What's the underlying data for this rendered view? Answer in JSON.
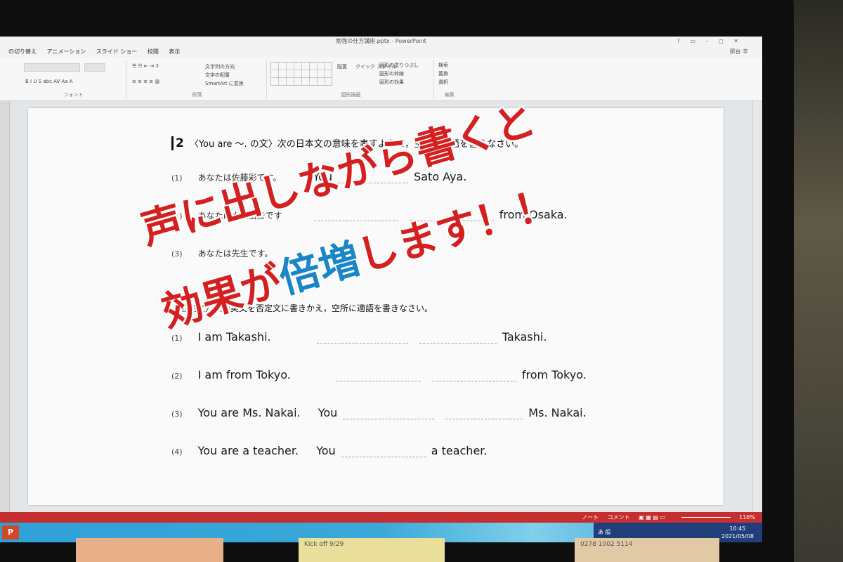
{
  "window": {
    "title": "勉強の仕方講座.pptx - PowerPoint",
    "controls": "?  ▭  –  ◻  ✕"
  },
  "tabs": [
    "の切り替え",
    "アニメーション",
    "スライド ショー",
    "校閲",
    "表示"
  ],
  "user": "那台 辛",
  "ribbon": {
    "groups": [
      "フォント",
      "段落",
      "図形描画",
      "編集"
    ],
    "items": {
      "text_direction": "文字列の方向",
      "align_text": "文字の配置",
      "smartart": "SmartArt に変換",
      "arrange": "配置",
      "quick_styles": "クイック スタイル",
      "fill": "図形の塗りつぶし",
      "outline": "図形の枠線",
      "effects": "図形の効果",
      "find": "検索",
      "replace": "置換",
      "select": "選択"
    }
  },
  "slide": {
    "q2_num": "2",
    "q2_title": "〈You are ～. の文〉次の日本文の意味を表すように，空所に適語を書きなさい。",
    "q2_rows": [
      {
        "n": "(1)",
        "jp": "あなたは佐藤彩です。",
        "a": "You",
        "b": "Sato Aya."
      },
      {
        "n": "(2)",
        "jp": "あなたは大阪出身です",
        "a": "",
        "b": "from Osaka."
      },
      {
        "n": "(3)",
        "jp": "あなたは先生です。",
        "a": "",
        "b": ""
      }
    ],
    "q3_title": "〈否定文〉次の英文を否定文に書きかえ，空所に適語を書きなさい。",
    "q3_rows": [
      {
        "n": "(1)",
        "en": "I am Takashi.",
        "a": "",
        "b": "Takashi."
      },
      {
        "n": "(2)",
        "en": "I am from Tokyo.",
        "a": "",
        "b": "from Tokyo."
      },
      {
        "n": "(3)",
        "en": "You are Ms. Nakai.",
        "a": "You",
        "b": "Ms. Nakai."
      },
      {
        "n": "(4)",
        "en": "You are a teacher.",
        "a": "You",
        "b": "a teacher."
      }
    ]
  },
  "overlay": {
    "line1": "声に出しながら書くと",
    "line2_a": "効果が",
    "line2_b": "倍増",
    "line2_c": "します！！"
  },
  "statusbar": {
    "notes": "ノート",
    "comments": "コメント",
    "zoom": "116%"
  },
  "taskbar": {
    "app_icon": "P",
    "ime": "あ 般",
    "time": "10:45",
    "date": "2021/05/08"
  },
  "stickies": {
    "s1": "",
    "s2": "Kick off 9/29",
    "s3": "0278 1002 5114"
  },
  "colors": {
    "overlay_red": "#d42020",
    "overlay_blue": "#1a86c8",
    "status_red": "#c62f2f"
  }
}
